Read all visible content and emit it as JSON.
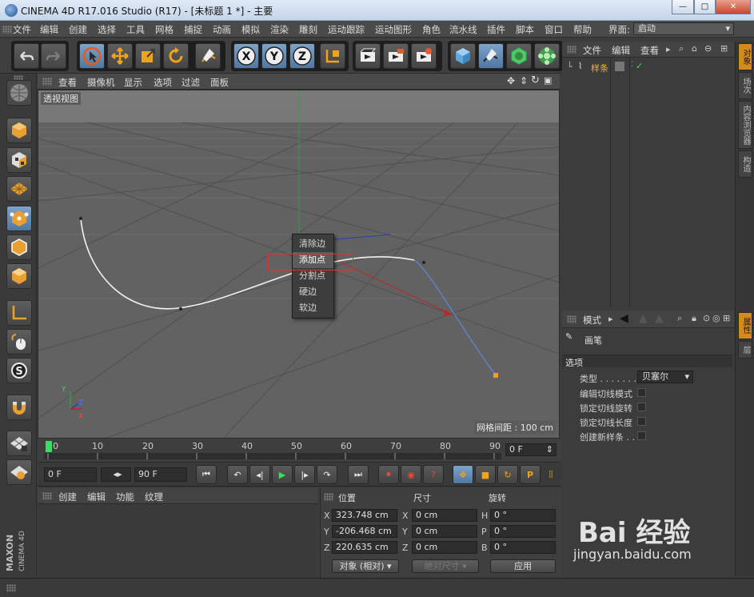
{
  "window": {
    "title": "CINEMA 4D R17.016 Studio (R17) - [未标题 1 *] - 主要",
    "controls": [
      "—",
      "□",
      "✕"
    ]
  },
  "menubar": {
    "items": [
      "文件",
      "编辑",
      "创建",
      "选择",
      "工具",
      "网格",
      "捕捉",
      "动画",
      "模拟",
      "渲染",
      "雕刻",
      "运动跟踪",
      "运动图形",
      "角色",
      "流水线",
      "插件",
      "脚本",
      "窗口",
      "帮助"
    ],
    "layout_label": "界面:",
    "layout_value": "启动"
  },
  "toolbar": {
    "buttons": [
      {
        "icon": "undo-icon",
        "selected": false
      },
      {
        "icon": "redo-icon",
        "selected": false
      },
      {
        "icon": "live-select-icon",
        "selected": true
      },
      {
        "icon": "move-icon",
        "selected": false
      },
      {
        "icon": "scale-icon",
        "selected": false
      },
      {
        "icon": "rotate-icon",
        "selected": false
      },
      {
        "icon": "pen-tool-icon",
        "selected": false
      },
      {
        "icon": "x-axis-icon",
        "selected": false
      },
      {
        "icon": "y-axis-icon",
        "selected": false
      },
      {
        "icon": "z-axis-icon",
        "selected": false
      },
      {
        "icon": "coordinate-system-icon",
        "selected": false
      },
      {
        "icon": "render-view-icon",
        "selected": false
      },
      {
        "icon": "render-to-picture-viewer-icon",
        "selected": false
      },
      {
        "icon": "render-settings-icon",
        "selected": false
      },
      {
        "icon": "cube-icon",
        "selected": false
      },
      {
        "icon": "pen-spline-icon",
        "selected": true
      },
      {
        "icon": "subdivision-icon",
        "selected": false
      },
      {
        "icon": "cloner-icon",
        "selected": false
      }
    ]
  },
  "left_tools": {
    "buttons": [
      "model-mode-icon",
      "object-mode-icon",
      "texture-mode-icon",
      "workplane-icon",
      "points-mode-icon",
      "edges-mode-icon",
      "polygons-mode-icon",
      "axis-mode-icon",
      "tweak-mode-icon",
      "solo-icon",
      "snap-icon",
      "workplane-grid-icon",
      "locked-workplane-icon"
    ]
  },
  "viewport": {
    "menu": [
      "查看",
      "摄像机",
      "显示",
      "选项",
      "过滤",
      "面板"
    ],
    "view_name": "透视视图",
    "grid_spacing": "网格间距 : 100 cm",
    "context_menu": {
      "items": [
        "清除边",
        "添加点",
        "分割点",
        "硬边",
        "软边"
      ],
      "highlighted_index": 1
    }
  },
  "timeline": {
    "ticks": [
      "0",
      "10",
      "20",
      "30",
      "40",
      "50",
      "60",
      "70",
      "80",
      "90"
    ],
    "current_frame": "0 F"
  },
  "playback": {
    "start_frame": "0 F",
    "end_frame": "90 F"
  },
  "material_manager": {
    "menu": [
      "创建",
      "编辑",
      "功能",
      "纹理"
    ]
  },
  "coordinates": {
    "headers": {
      "position": "位置",
      "size": "尺寸",
      "rotation": "旋转"
    },
    "rows": [
      {
        "axis": "X",
        "position": "323.748 cm",
        "size_axis": "X",
        "size": "0 cm",
        "rot_axis": "H",
        "rotation": "0 °"
      },
      {
        "axis": "Y",
        "position": "-206.468 cm",
        "size_axis": "Y",
        "size": "0 cm",
        "rot_axis": "P",
        "rotation": "0 °"
      },
      {
        "axis": "Z",
        "position": "220.635 cm",
        "size_axis": "Z",
        "size": "0 cm",
        "rot_axis": "B",
        "rotation": "0 °"
      }
    ],
    "mode_select": "对象 (相对)",
    "size_select": "绝对尺寸",
    "apply": "应用"
  },
  "object_manager": {
    "menu": [
      "文件",
      "编辑",
      "查看"
    ],
    "objects": [
      {
        "name": "样条"
      }
    ]
  },
  "right_tabs": {
    "top": [
      "对象",
      "场次",
      "内容浏览器",
      "构造"
    ],
    "bottom": [
      "属性",
      "层"
    ]
  },
  "attributes": {
    "menu_mode": "模式",
    "object_name": "画笔",
    "section": "选项",
    "type_label": "类型 . . . . . . . . .",
    "type_value": "贝塞尔",
    "options": [
      "编辑切线模式",
      "锁定切线旋转",
      "锁定切线长度",
      "创建新样条 . ."
    ]
  },
  "branding": {
    "vertical_logo_1": "MAXON",
    "vertical_logo_2": "CINEMA 4D"
  },
  "watermark": {
    "brand": "Bai 经验",
    "url": "jingyan.baidu.com"
  },
  "colors": {
    "accent_orange": "#d38a1f",
    "selected_blue": "#6e93bb",
    "highlight_red": "#d33333"
  }
}
